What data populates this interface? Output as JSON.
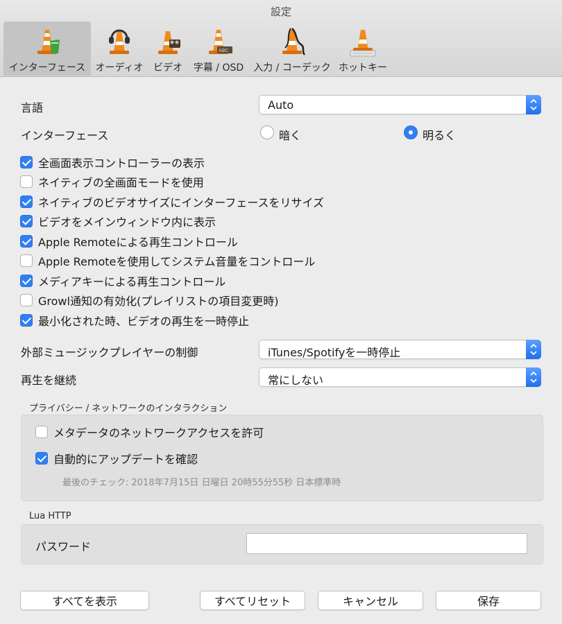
{
  "window": {
    "title": "設定"
  },
  "tabs": [
    {
      "label": "インターフェース",
      "icon": "vlc-interface-icon",
      "active": true
    },
    {
      "label": "オーディオ",
      "icon": "vlc-audio-icon",
      "active": false
    },
    {
      "label": "ビデオ",
      "icon": "vlc-video-icon",
      "active": false
    },
    {
      "label": "字幕 / OSD",
      "icon": "vlc-subtitles-icon",
      "active": false
    },
    {
      "label": "入力 / コーデック",
      "icon": "vlc-input-icon",
      "active": false
    },
    {
      "label": "ホットキー",
      "icon": "vlc-hotkeys-icon",
      "active": false
    }
  ],
  "language": {
    "label": "言語",
    "value": "Auto"
  },
  "interface_style": {
    "label": "インターフェース",
    "dark": "暗く",
    "light": "明るく",
    "selected": "light"
  },
  "checkboxes": [
    {
      "label": "全画面表示コントローラーの表示",
      "checked": true
    },
    {
      "label": "ネイティブの全画面モードを使用",
      "checked": false
    },
    {
      "label": "ネイティブのビデオサイズにインターフェースをリサイズ",
      "checked": true
    },
    {
      "label": "ビデオをメインウィンドウ内に表示",
      "checked": true
    },
    {
      "label": "Apple Remoteによる再生コントロール",
      "checked": true
    },
    {
      "label": "Apple Remoteを使用してシステム音量をコントロール",
      "checked": false
    },
    {
      "label": "メディアキーによる再生コントロール",
      "checked": true
    },
    {
      "label": "Growl通知の有効化(プレイリストの項目変更時)",
      "checked": false
    },
    {
      "label": "最小化された時、ビデオの再生を一時停止",
      "checked": true
    }
  ],
  "external_player": {
    "label": "外部ミュージックプレイヤーの制御",
    "value": "iTunes/Spotifyを一時停止"
  },
  "continue_playback": {
    "label": "再生を継続",
    "value": "常にしない"
  },
  "privacy": {
    "title": "プライバシー / ネットワークのインタラクション",
    "metadata": {
      "label": "メタデータのネットワークアクセスを許可",
      "checked": false
    },
    "updates": {
      "label": "自動的にアップデートを確認",
      "checked": true
    },
    "last_check": "最後のチェック: 2018年7月15日 日曜日 20時55分55秒 日本標準時"
  },
  "lua": {
    "title": "Lua HTTP",
    "password_label": "パスワード",
    "password_value": ""
  },
  "buttons": {
    "show_all": "すべてを表示",
    "reset_all": "すべてリセット",
    "cancel": "キャンセル",
    "save": "保存"
  },
  "colors": {
    "accent": "#2f7ff5",
    "cone_orange": "#f08a1c"
  }
}
